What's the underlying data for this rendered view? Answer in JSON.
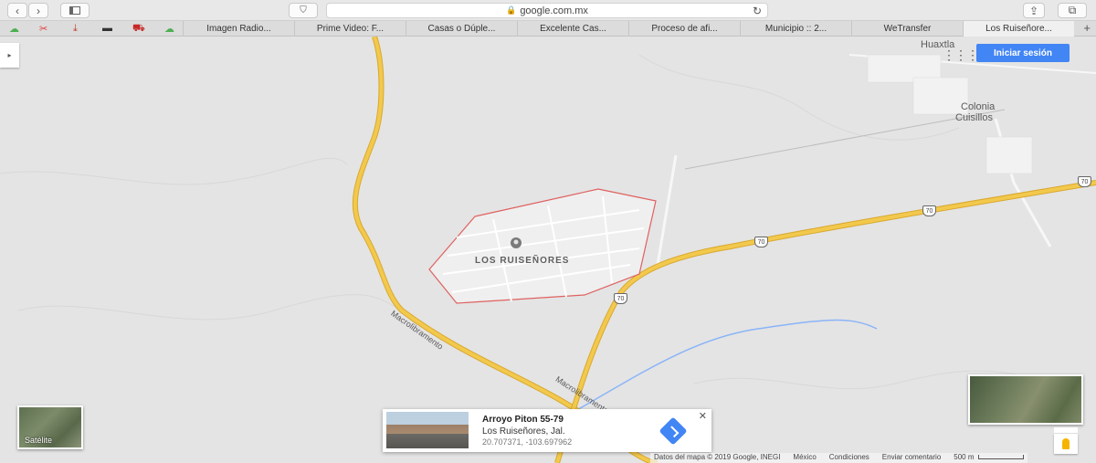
{
  "browser": {
    "url": "google.com.mx",
    "back_icon": "chevron-left-icon",
    "forward_icon": "chevron-right-icon",
    "sidebar_icon": "sidebar-icon",
    "shield_icon": "shield-icon",
    "reload_icon": "reload-icon",
    "share_icon": "share-icon",
    "tabs_icon": "tabs-icon"
  },
  "bookmarks": {
    "icons": [
      "cloud-icon",
      "tools-icon",
      "pin-icon",
      "car-icon",
      "truck-icon",
      "cloud-icon"
    ],
    "tabs": [
      "Imagen Radio...",
      "Prime Video: F...",
      "Casas o Dúple...",
      "Excelente Cas...",
      "Proceso de afi...",
      "Municipio :: 2...",
      "WeTransfer",
      "Los Ruiseñore..."
    ],
    "active_index": 7,
    "plus": "+"
  },
  "map": {
    "signin_label": "Iniciar sesión",
    "apps_icon": "apps-grid-icon",
    "side_toggle": "▸",
    "places": {
      "main": "LOS RUISEÑORES",
      "huaxtla": "Huaxtla",
      "colonia_1": "Colonia",
      "colonia_2": "Cuisillos"
    },
    "road_names": {
      "macro_1": "Macrolibramento",
      "macro_2": "Macrolibramento"
    },
    "shields": [
      "70",
      "70",
      "70",
      "70"
    ],
    "satellite_label": "Satélite",
    "card": {
      "title": "Arroyo Piton 55-79",
      "subtitle": "Los Ruiseñores, Jal.",
      "coords": "20.707371, -103.697962",
      "close": "✕"
    },
    "attribution": {
      "data": "Datos del mapa © 2019 Google, INEGI",
      "country": "México",
      "terms": "Condiciones",
      "feedback": "Enviar comentario",
      "scale": "500 m"
    },
    "colors": {
      "highway": "#f2c94c",
      "highway_edge": "#d9a830",
      "boundary": "#e06060",
      "water": "#8ab4f8"
    }
  }
}
